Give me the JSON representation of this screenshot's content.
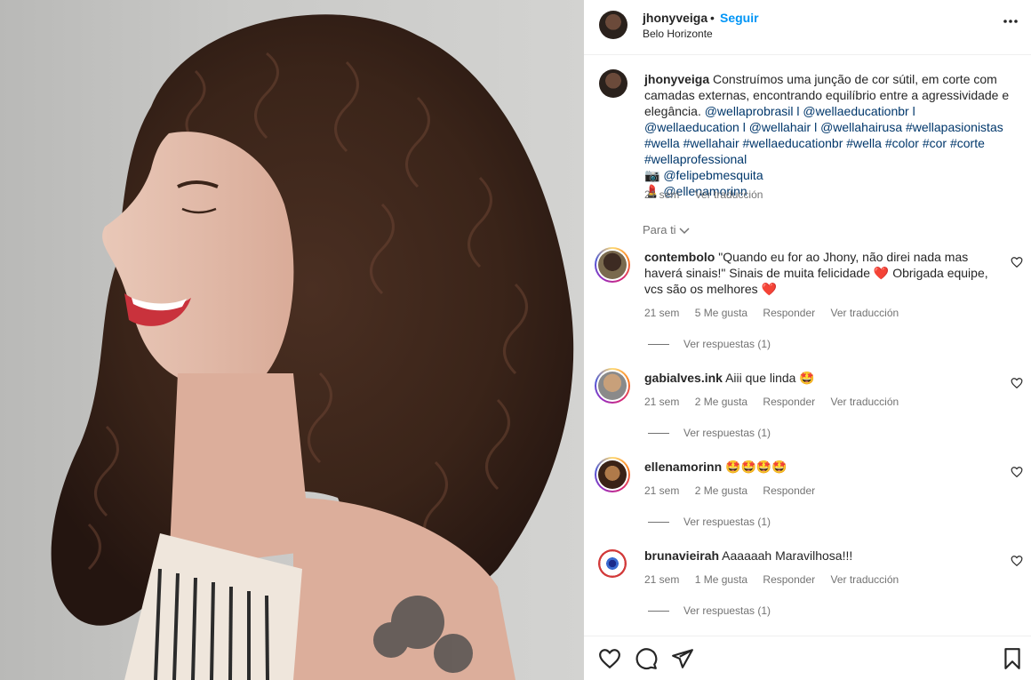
{
  "post": {
    "username": "jhonyveiga",
    "dot": "•",
    "follow_label": "Seguir",
    "location": "Belo Horizonte",
    "more_icon": "more-horizontal-icon"
  },
  "caption": {
    "username": "jhonyveiga",
    "text_1": "Construímos uma junção de cor sútil, em corte com camadas externas, encontrando equilíbrio entre a agressividade e elegância.",
    "tags_line": "@wellaprobrasil l @wellaeducationbr l @wellaeducation l @wellahair l @wellahairusa #wellapasionistas #wella #wellahair #wellaeducationbr #wella #color #cor #corte #wellaprofessional",
    "camera_emoji": "📷",
    "photo_credit": "@felipebmesquita",
    "lipstick_emoji": "💄",
    "makeup_credit": "@ellenamorinn",
    "time": "21 sem",
    "translate": "Ver traducción"
  },
  "filter": {
    "label": "Para ti",
    "icon": "chevron-down-icon"
  },
  "comments": [
    {
      "username": "contembolo",
      "text": "\"Quando eu for ao Jhony, não direi nada mas haverá sinais!\" Sinais de muita felicidade ❤️ Obrigada equipe, vcs são os melhores ❤️",
      "time": "21 sem",
      "likes": "5 Me gusta",
      "reply": "Responder",
      "translate": "Ver traducción",
      "replies": "Ver respuestas (1)"
    },
    {
      "username": "gabialves.ink",
      "text": "Aiii que linda 🤩",
      "time": "21 sem",
      "likes": "2 Me gusta",
      "reply": "Responder",
      "translate": "Ver traducción",
      "replies": "Ver respuestas (1)"
    },
    {
      "username": "ellenamorinn",
      "text": "🤩🤩🤩🤩",
      "time": "21 sem",
      "likes": "2 Me gusta",
      "reply": "Responder",
      "translate": "",
      "replies": "Ver respuestas (1)"
    },
    {
      "username": "brunavieirah",
      "text": "Aaaaaah Maravilhosa!!!",
      "time": "21 sem",
      "likes": "1 Me gusta",
      "reply": "Responder",
      "translate": "Ver traducción",
      "replies": "Ver respuestas (1)"
    }
  ],
  "actions": {
    "like_icon": "heart-icon",
    "comment_icon": "comment-icon",
    "share_icon": "share-icon",
    "save_icon": "bookmark-icon"
  },
  "colors": {
    "accent": "#0095f6",
    "link": "#00376b",
    "muted": "#737373",
    "text": "#262626"
  }
}
